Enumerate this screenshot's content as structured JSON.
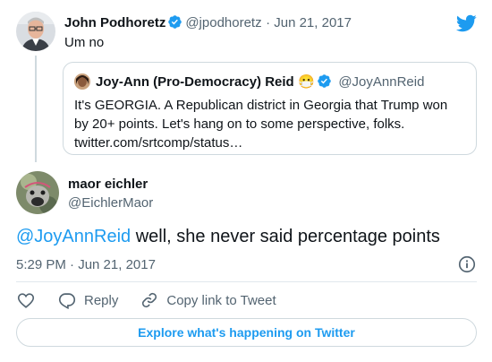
{
  "parent_tweet": {
    "author_name": "John Podhoretz",
    "author_handle": "@jpodhoretz",
    "date": "· Jun 21, 2017",
    "text": "Um no",
    "avatar_icon": "man-glasses-avatar",
    "quoted": {
      "author_name": "Joy-Ann (Pro-Democracy) Reid",
      "author_emoji": "😷",
      "author_handle": "@JoyAnnReid",
      "text_line1": "It's GEORGIA. A Republican district in Georgia that Trump won",
      "text_line2": "by 20+ points. Let's hang on to some perspective, folks.",
      "text_line3": "twitter.com/srtcomp/status…"
    }
  },
  "tweet": {
    "author_name": "maor eichler",
    "author_handle": "@EichlerMaor",
    "mention": "@JoyAnnReid",
    "text_rest": " well, she never said percentage points",
    "time": "5:29 PM · Jun 21, 2017"
  },
  "actions": {
    "like_icon": "heart-icon",
    "reply_label": "Reply",
    "copy_label": "Copy link to Tweet"
  },
  "explore_label": "Explore what's happening on Twitter",
  "colors": {
    "accent": "#1d9bf0",
    "text": "#0f1419",
    "secondary": "#536471",
    "border": "#cfd9de"
  }
}
